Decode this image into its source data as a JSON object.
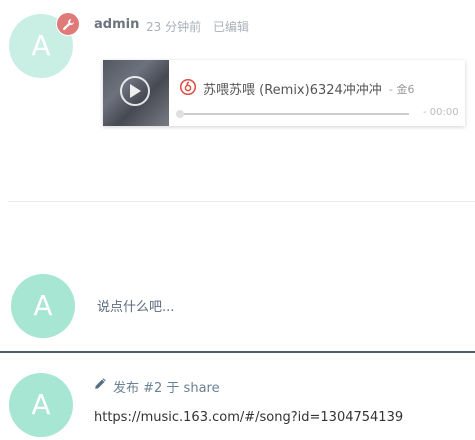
{
  "post1": {
    "avatar_letter": "A",
    "author": "admin",
    "time": "23 分钟前",
    "edited": "已编辑",
    "player": {
      "song_title": "苏喂苏喂 (Remix)6324冲冲冲",
      "artist": " - 金6",
      "time": "- 00:00",
      "progress": 0
    }
  },
  "comment_box": {
    "avatar_letter": "A",
    "placeholder": "说点什么吧..."
  },
  "post2": {
    "avatar_letter": "A",
    "action_text": "发布 #2 于 share",
    "content": "https://music.163.com/#/song?id=1304754139"
  },
  "colors": {
    "avatar_light": "#c9efe4",
    "avatar": "#a6e6d2",
    "admin_badge": "#e07a78",
    "netease_red": "#e34e45",
    "divider_dark": "#4f5d6d"
  }
}
